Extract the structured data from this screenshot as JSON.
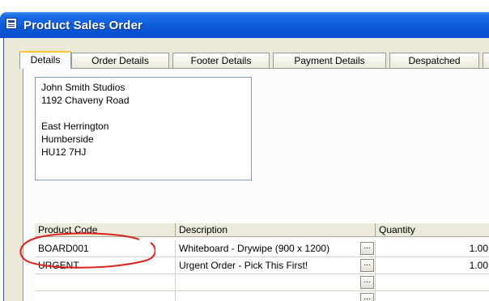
{
  "window": {
    "title": "Product Sales Order",
    "icon": "form-icon"
  },
  "tabs": [
    {
      "label": "Details",
      "active": true
    },
    {
      "label": "Order Details",
      "active": false
    },
    {
      "label": "Footer Details",
      "active": false
    },
    {
      "label": "Payment Details",
      "active": false
    },
    {
      "label": "Despatched",
      "active": false
    }
  ],
  "address": {
    "lines": [
      "John Smith Studios",
      "1192 Chaveny Road",
      "",
      "East Herrington",
      "Humberside",
      "HU12 7HJ"
    ]
  },
  "grid": {
    "columns": [
      "Product Code",
      "Description",
      "Quantity"
    ],
    "rows": [
      {
        "code": "BOARD001",
        "description": "Whiteboard - Drywipe (900 x 1200)",
        "quantity": "1.00"
      },
      {
        "code": "URGENT",
        "description": "Urgent Order - Pick This First!",
        "quantity": "1.00"
      },
      {
        "code": "",
        "description": "",
        "quantity": ""
      },
      {
        "code": "",
        "description": "",
        "quantity": ""
      }
    ],
    "lookup_button_label": "..."
  },
  "colors": {
    "titlebar": "#0a57d6",
    "active_tab_accent": "#ffc83c",
    "annotation": "#e0201b"
  }
}
